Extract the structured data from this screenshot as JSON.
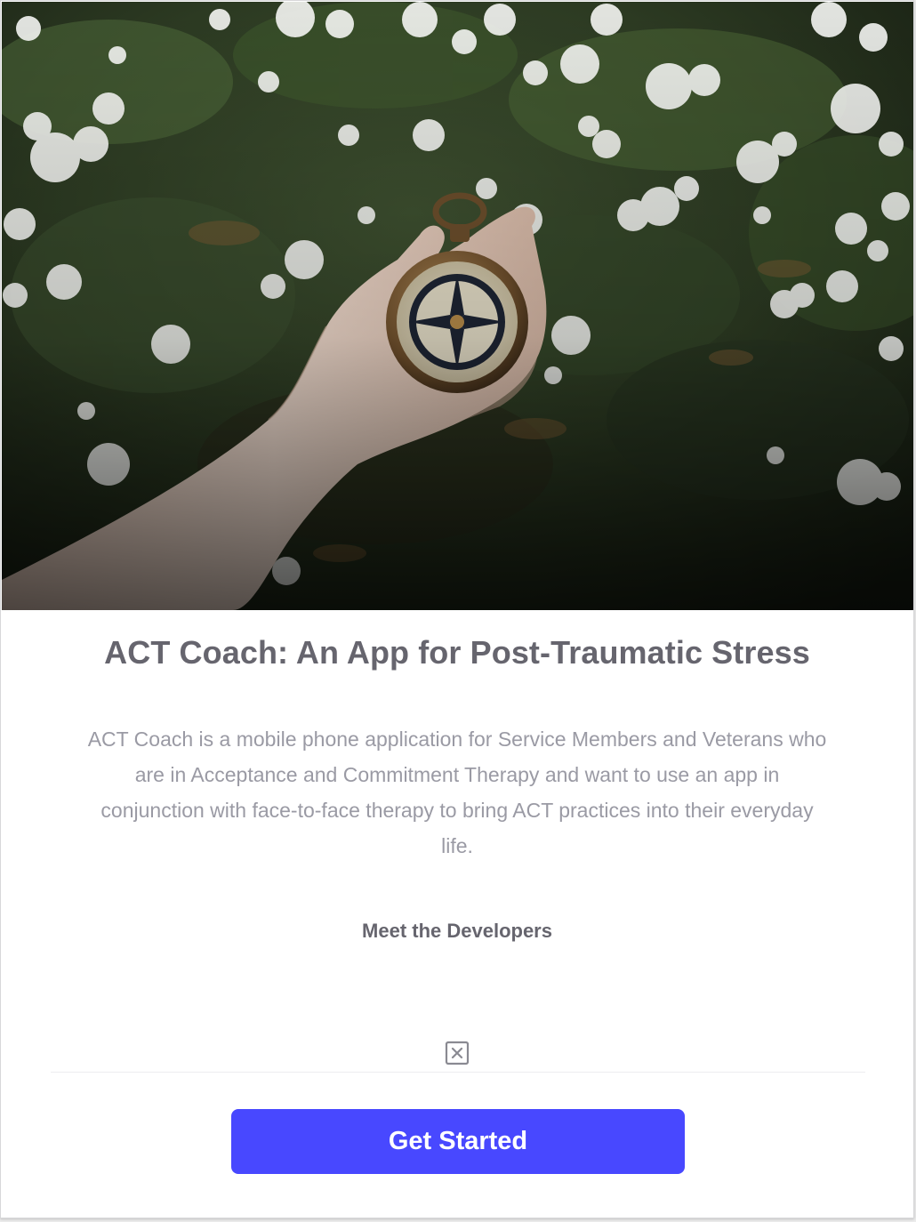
{
  "hero": {
    "image": "compass-in-hand-among-white-flowers"
  },
  "main": {
    "title": "ACT Coach: An App for Post-Traumatic Stress",
    "description": "ACT Coach is a mobile phone application for Service Members and Veterans who are in Acceptance and Commitment Therapy and want to use an app in conjunction with face-to-face therapy to bring ACT practices into their everyday life.",
    "developers_link": "Meet the Developers",
    "broken_image_icon": "broken-image-icon"
  },
  "footer": {
    "cta_label": "Get Started"
  },
  "colors": {
    "accent": "#4848ff",
    "title": "#66656e",
    "body_text": "#9a9aa4"
  }
}
